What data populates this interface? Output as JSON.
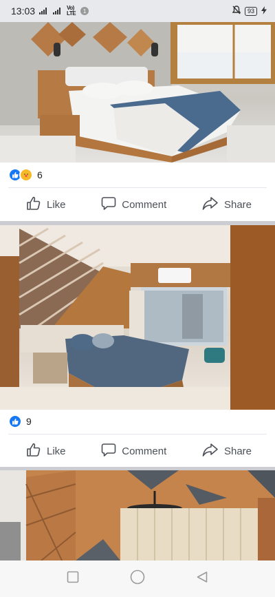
{
  "status_bar": {
    "time": "13:03",
    "network_label": "Vo) LTE",
    "notification_count": "1",
    "battery": "93"
  },
  "posts": [
    {
      "reaction_count": "6",
      "reactions": [
        "like-icon",
        "care-icon"
      ],
      "actions": {
        "like": "Like",
        "comment": "Comment",
        "share": "Share"
      }
    },
    {
      "reaction_count": "9",
      "reactions": [
        "like-icon"
      ],
      "actions": {
        "like": "Like",
        "comment": "Comment",
        "share": "Share"
      }
    }
  ],
  "nav_bar": [
    "recent-apps-icon",
    "home-icon",
    "back-icon"
  ],
  "colors": {
    "accent": "#1877f2",
    "divider": "#e4e6eb",
    "separator": "#cbcdd2"
  }
}
